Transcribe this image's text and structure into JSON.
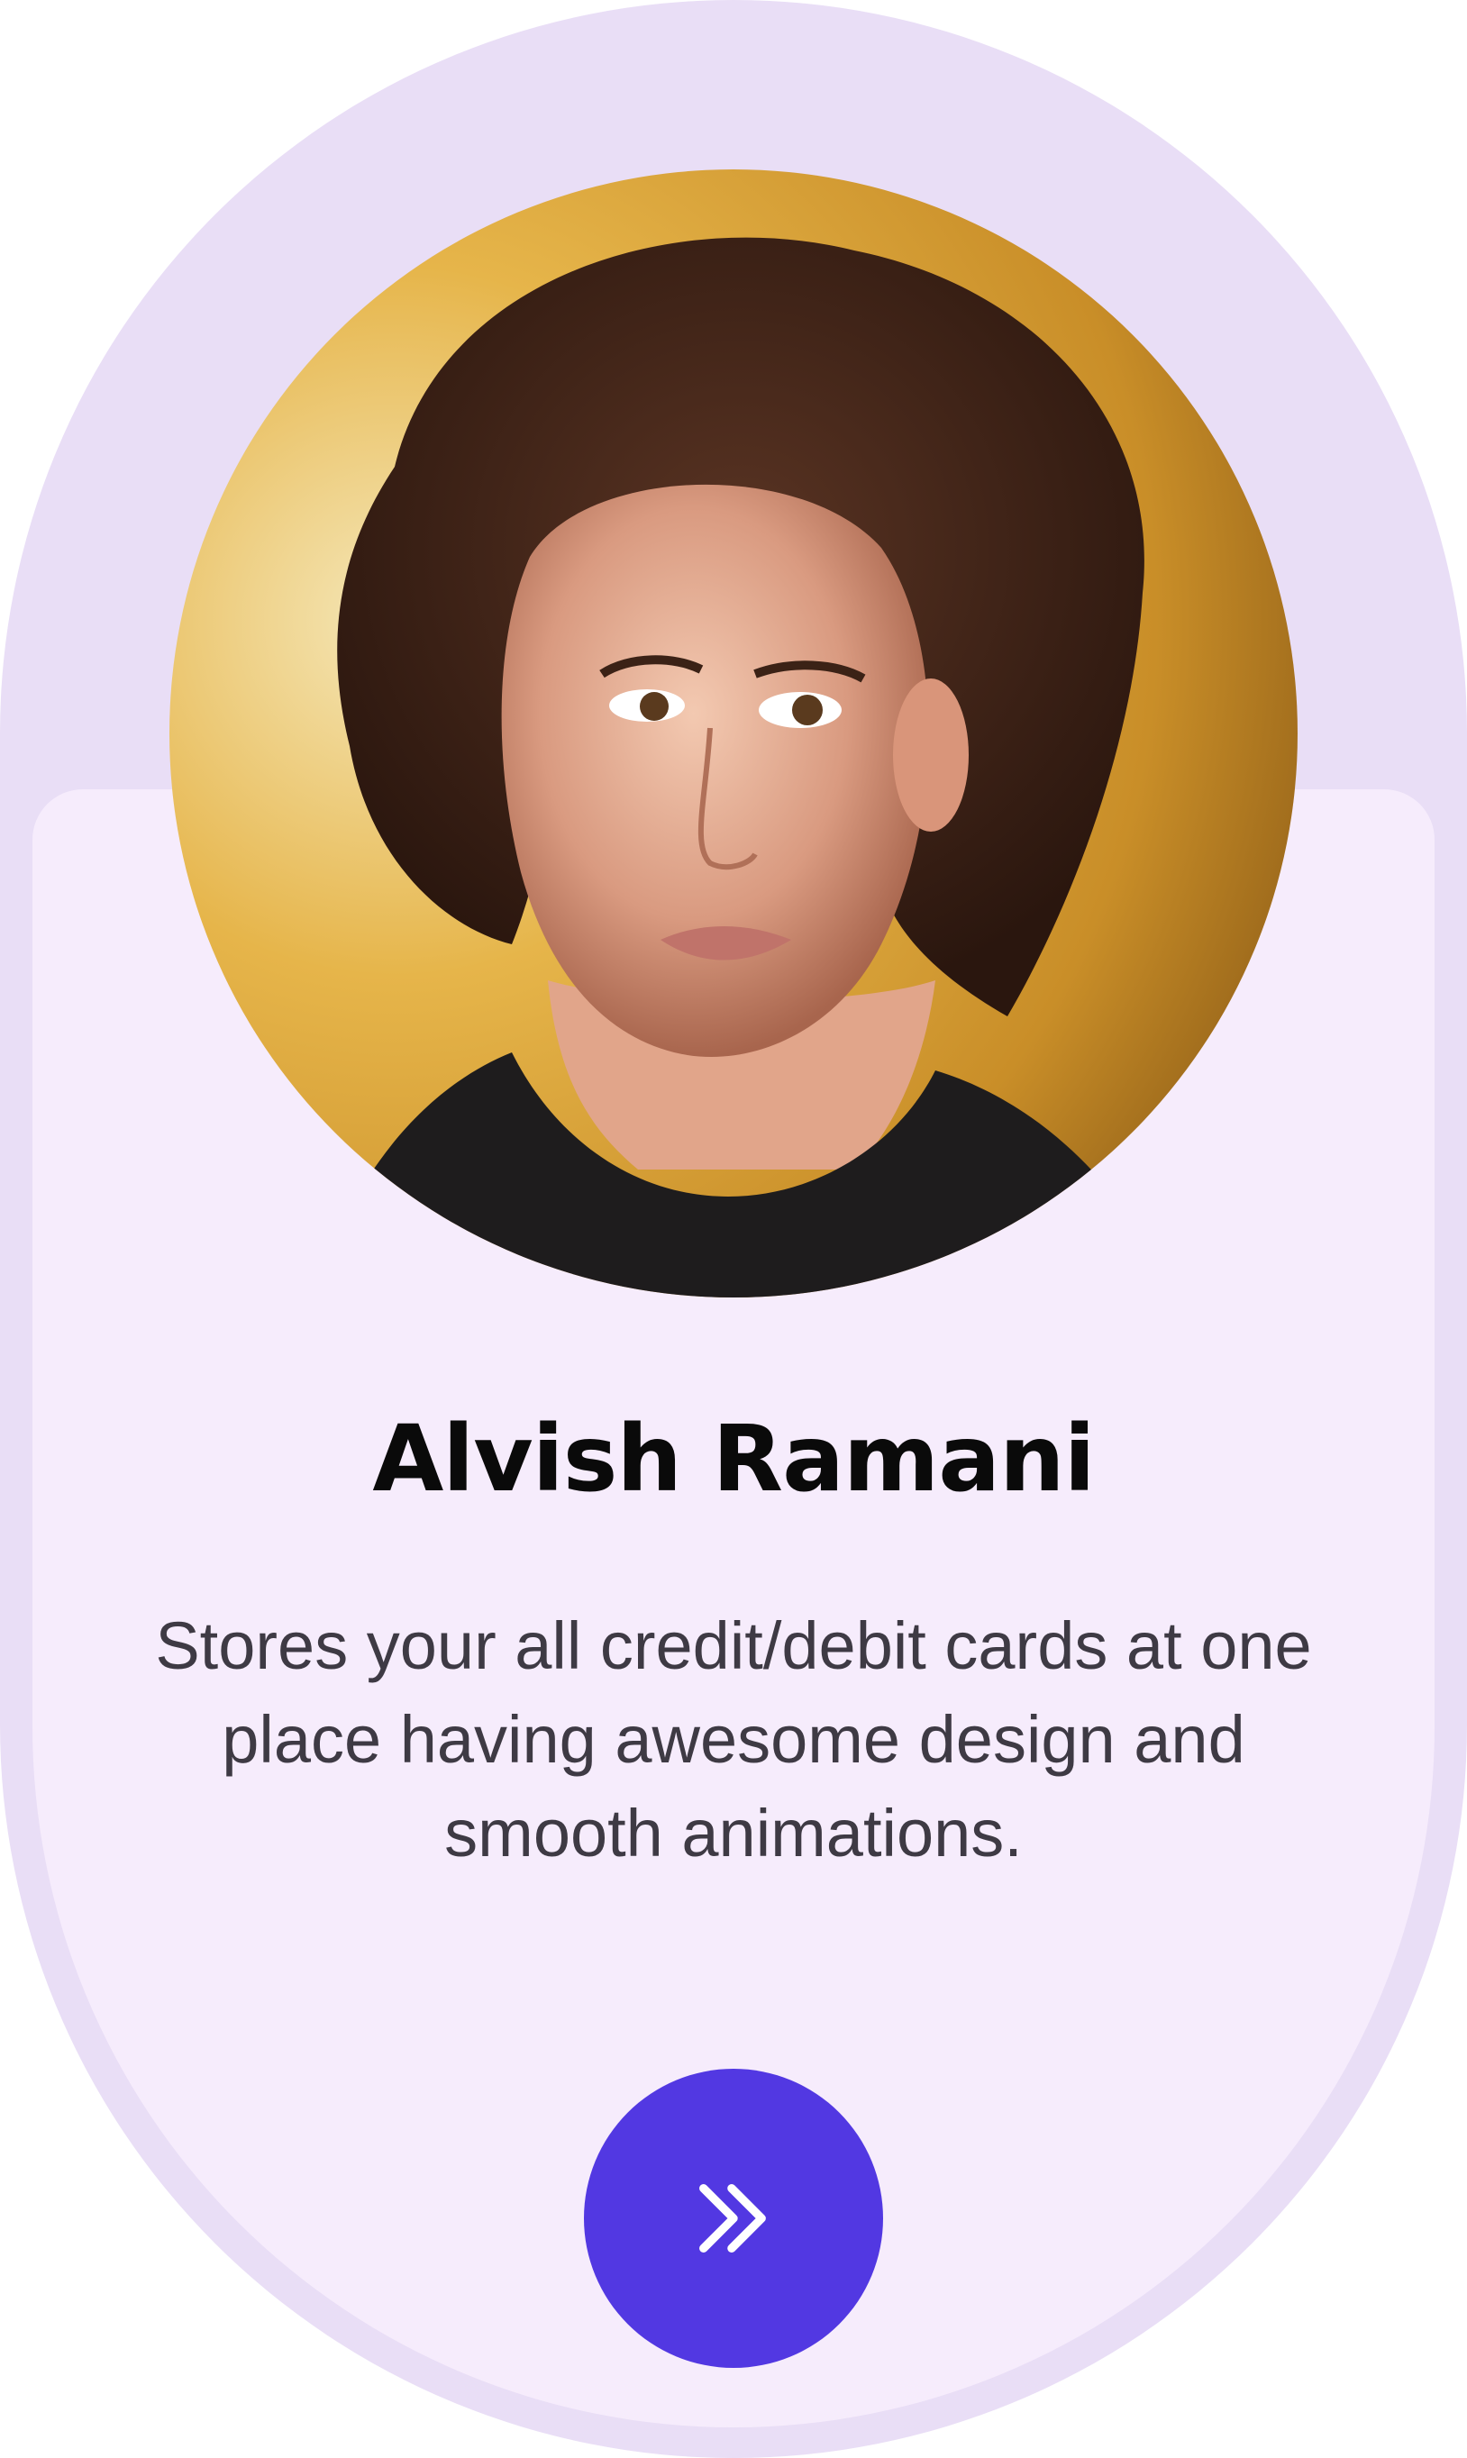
{
  "profile": {
    "name": "Alvish Ramani",
    "description": "Stores your all credit/debit cards at one place having awesome design and smooth animations.",
    "avatar_alt": "profile photo"
  },
  "actions": {
    "next_icon": "double-chevron-right-icon"
  },
  "colors": {
    "outer_background": "#e9def6",
    "card_background": "#f6ecfc",
    "accent": "#5238e2",
    "title_text": "#0a0a0a",
    "body_text": "#3e3a44"
  }
}
